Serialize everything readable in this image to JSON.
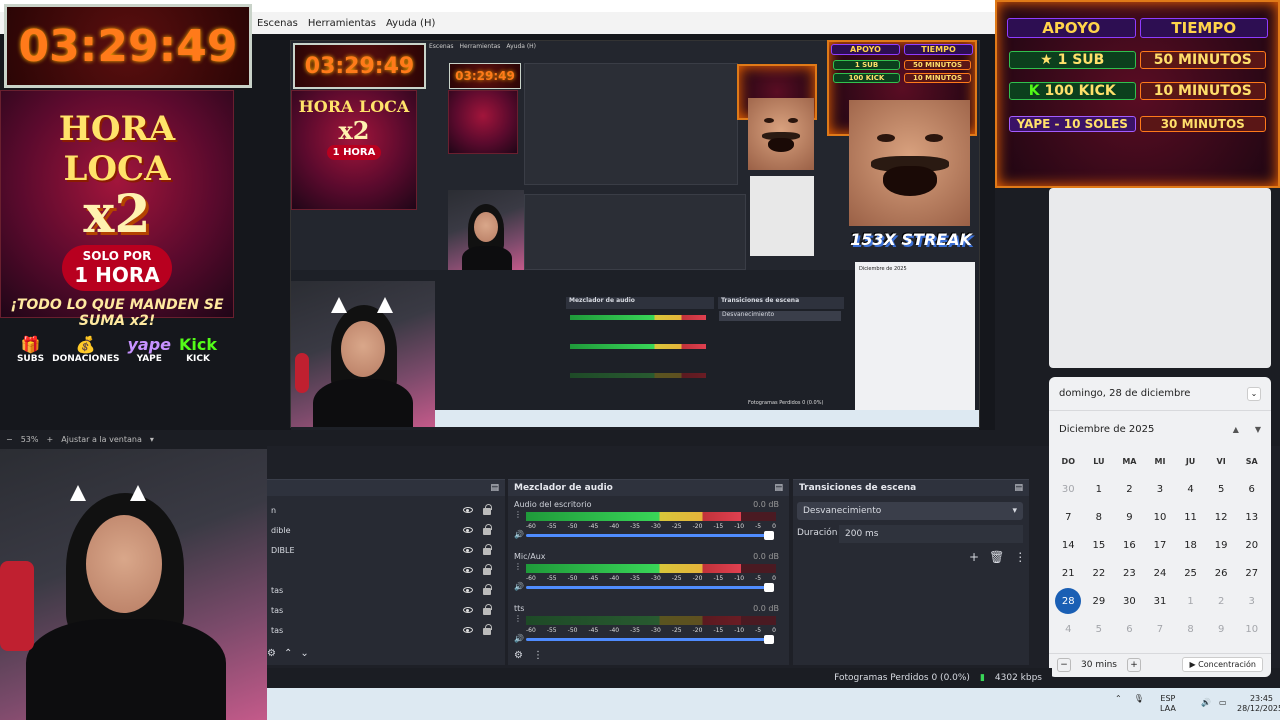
{
  "menu": {
    "items": [
      "Escenas",
      "Herramientas",
      "Ayuda (H)"
    ]
  },
  "timer": {
    "main": "03:29:49",
    "preview": "03:29:49",
    "mini": "03:29:49"
  },
  "hora_loca": {
    "title": "HORA LOCA",
    "multiplier": "x2",
    "duration_line1": "SOLO POR",
    "duration_line2": "1 HORA",
    "tagline": "¡TODO LO QUE MANDEN SE SUMA x2!",
    "pills": [
      {
        "label": "SUBS",
        "icon": "gift-icon"
      },
      {
        "label": "DONACIONES",
        "icon": "coin-icon"
      },
      {
        "label": "YAPE",
        "icon": "yape-icon"
      },
      {
        "label": "KICK",
        "icon": "kick-icon"
      }
    ],
    "pill_brand": {
      "yape": "yape",
      "kick": "Kick"
    }
  },
  "apoyo": {
    "header_left": "APOYO",
    "header_right": "TIEMPO",
    "rows": [
      {
        "left": "1 SUB",
        "right": "50 MINUTOS"
      },
      {
        "left": "100 KICK",
        "right": "10 MINUTOS"
      },
      {
        "left": "YAPE - 10 SOLES",
        "right": "30 MINUTOS"
      }
    ]
  },
  "streak": {
    "label": "153X STREAK"
  },
  "zoom": {
    "value": "53%",
    "fit": "Ajustar a la ventana"
  },
  "sources": {
    "items": [
      {
        "name": "n"
      },
      {
        "name": "dible"
      },
      {
        "name": "DIBLE"
      },
      {
        "name": ""
      },
      {
        "name": "tas"
      },
      {
        "name": "tas"
      },
      {
        "name": "tas"
      }
    ]
  },
  "mixer": {
    "title": "Mezclador de audio",
    "channels": [
      {
        "name": "Audio del escritorio",
        "db": "0.0 dB",
        "level": 0.86,
        "active": true
      },
      {
        "name": "Mic/Aux",
        "db": "0.0 dB",
        "level": 0.86,
        "active": true
      },
      {
        "name": "tts",
        "db": "0.0 dB",
        "level": 0.86,
        "active": false
      }
    ],
    "ticks": [
      "-60",
      "-55",
      "-50",
      "-45",
      "-40",
      "-35",
      "-30",
      "-25",
      "-20",
      "-15",
      "-10",
      "-5",
      "0"
    ]
  },
  "transitions": {
    "title": "Transiciones de escena",
    "selected": "Desvanecimiento",
    "duration_label": "Duración",
    "duration_value": "200 ms"
  },
  "calendar": {
    "date_header": "domingo, 28 de diciembre",
    "month": "Diciembre de 2025",
    "weekdays": [
      "DO",
      "LU",
      "MA",
      "MI",
      "JU",
      "VI",
      "SA"
    ],
    "days": [
      [
        "30",
        "1",
        "2",
        "3",
        "4",
        "5",
        "6"
      ],
      [
        "7",
        "8",
        "9",
        "10",
        "11",
        "12",
        "13"
      ],
      [
        "14",
        "15",
        "16",
        "17",
        "18",
        "19",
        "20"
      ],
      [
        "21",
        "22",
        "23",
        "24",
        "25",
        "26",
        "27"
      ],
      [
        "28",
        "29",
        "30",
        "31",
        "1",
        "2",
        "3"
      ],
      [
        "4",
        "5",
        "6",
        "7",
        "8",
        "9",
        "10"
      ]
    ],
    "focus_minutes": "30 mins",
    "focus_button": "Concentración"
  },
  "status": {
    "dropped": "Fotogramas Perdidos 0 (0.0%)",
    "bitrate": "4302 kbps"
  },
  "taskbar": {
    "lang_top": "ESP",
    "lang_bottom": "LAA",
    "time": "23:45",
    "date": "28/12/2025"
  },
  "colors": {
    "accent": "#1a5fb4",
    "meter_green": "#39d658",
    "meter_yellow": "#e6b43a",
    "meter_red": "#e04050"
  }
}
